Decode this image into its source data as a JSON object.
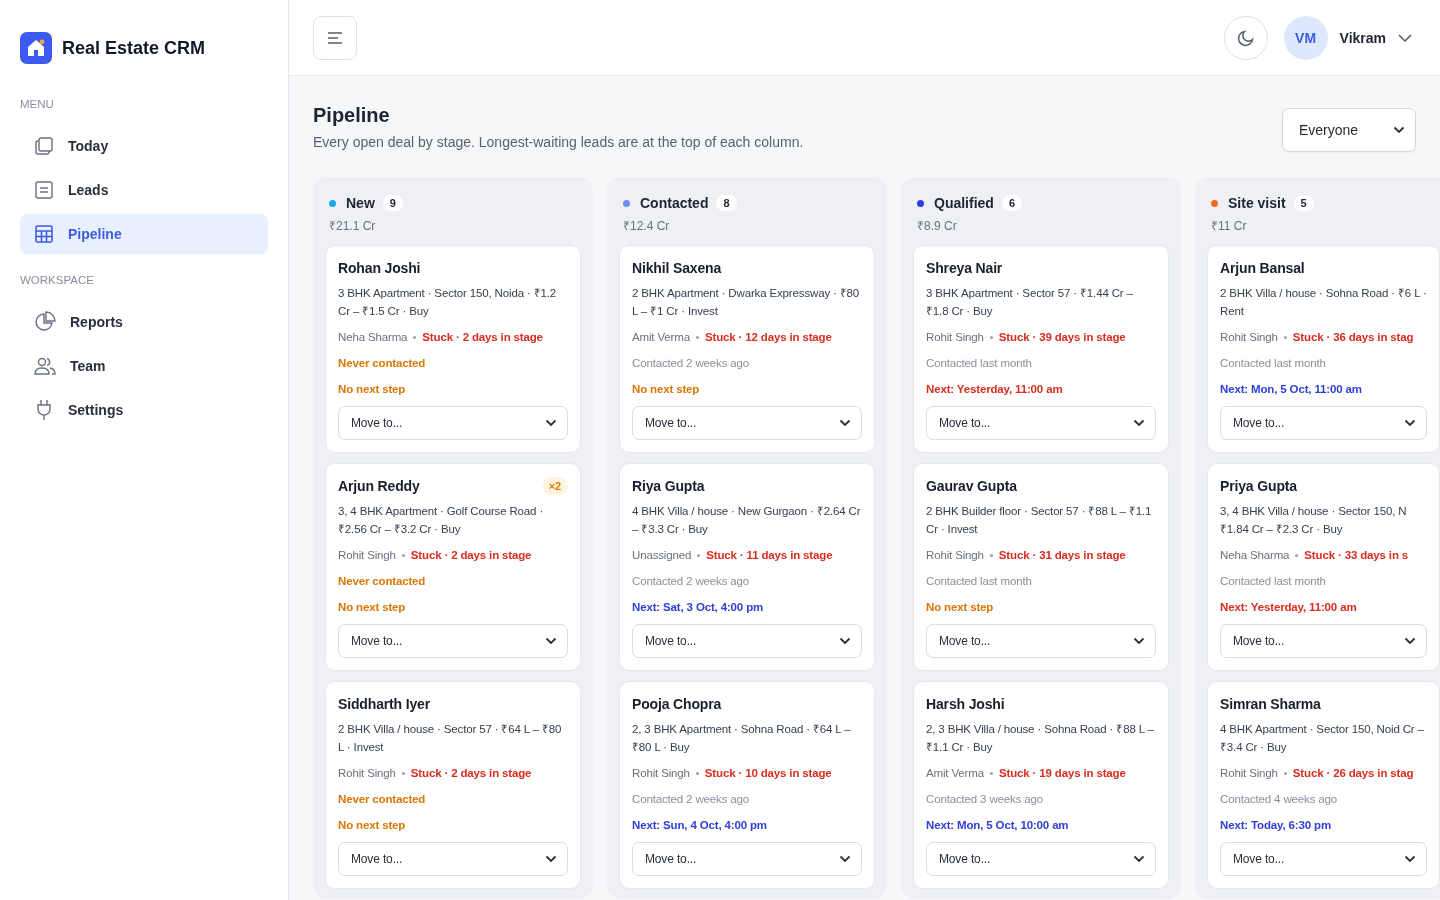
{
  "sidebar": {
    "brand": "Real Estate CRM",
    "sections": [
      {
        "title": "MENU",
        "items": [
          {
            "label": "Today",
            "selected": false
          },
          {
            "label": "Leads",
            "selected": false
          },
          {
            "label": "Pipeline",
            "selected": true
          }
        ]
      },
      {
        "title": "WORKSPACE",
        "items": [
          {
            "label": "Reports",
            "selected": false
          },
          {
            "label": "Team",
            "selected": false
          },
          {
            "label": "Settings",
            "selected": false
          }
        ]
      }
    ]
  },
  "header": {
    "user_initials": "VM",
    "user_name": "Vikram"
  },
  "page": {
    "title": "Pipeline",
    "subtitle": "Every open deal by stage. Longest-waiting leads are at the top of each column.",
    "filter": "Everyone"
  },
  "columns": [
    {
      "name": "New",
      "count": "9",
      "total": "₹21.1 Cr",
      "color": "#1ea7e8",
      "cards": [
        {
          "name": "Rohan Joshi",
          "description": "3 BHK Apartment · Sector 150, Noida · ₹1.2 Cr – ₹1.5 Cr · Buy",
          "owner": "Neha Sharma",
          "stuck": "Stuck · 2 days in stage",
          "contact": {
            "text": "Never contacted",
            "kind": "never"
          },
          "next": {
            "text": "No next step",
            "kind": "none"
          },
          "move": "Move to..."
        },
        {
          "name": "Arjun Reddy",
          "badge": "×2",
          "description": "3, 4 BHK Apartment · Golf Course Road · ₹2.56 Cr – ₹3.2 Cr · Buy",
          "owner": "Rohit Singh",
          "stuck": "Stuck · 2 days in stage",
          "contact": {
            "text": "Never contacted",
            "kind": "never"
          },
          "next": {
            "text": "No next step",
            "kind": "none"
          },
          "move": "Move to..."
        },
        {
          "name": "Siddharth Iyer",
          "description": "2 BHK Villa / house · Sector 57 · ₹64 L – ₹80 L · Invest",
          "owner": "Rohit Singh",
          "stuck": "Stuck · 2 days in stage",
          "contact": {
            "text": "Never contacted",
            "kind": "never"
          },
          "next": {
            "text": "No next step",
            "kind": "none"
          },
          "move": "Move to..."
        }
      ]
    },
    {
      "name": "Contacted",
      "count": "8",
      "total": "₹12.4 Cr",
      "color": "#6b8cf3",
      "cards": [
        {
          "name": "Nikhil Saxena",
          "description": "2 BHK Apartment · Dwarka Expressway · ₹80 L – ₹1 Cr · Invest",
          "owner": "Amit Verma",
          "stuck": "Stuck · 12 days in stage",
          "contact": {
            "text": "Contacted 2 weeks ago",
            "kind": "past"
          },
          "next": {
            "text": "No next step",
            "kind": "none"
          },
          "move": "Move to..."
        },
        {
          "name": "Riya Gupta",
          "description": "4 BHK Villa / house · New Gurgaon · ₹2.64 Cr – ₹3.3 Cr · Buy",
          "owner": "Unassigned",
          "stuck": "Stuck · 11 days in stage",
          "contact": {
            "text": "Contacted 2 weeks ago",
            "kind": "past"
          },
          "next": {
            "text": "Next: Sat, 3 Oct, 4:00 pm",
            "kind": "upcoming"
          },
          "move": "Move to..."
        },
        {
          "name": "Pooja Chopra",
          "description": "2, 3 BHK Apartment · Sohna Road · ₹64 L – ₹80 L · Buy",
          "owner": "Rohit Singh",
          "stuck": "Stuck · 10 days in stage",
          "contact": {
            "text": "Contacted 2 weeks ago",
            "kind": "past"
          },
          "next": {
            "text": "Next: Sun, 4 Oct, 4:00 pm",
            "kind": "upcoming"
          },
          "move": "Move to..."
        }
      ]
    },
    {
      "name": "Qualified",
      "count": "6",
      "total": "₹8.9 Cr",
      "color": "#2b3fe0",
      "cards": [
        {
          "name": "Shreya Nair",
          "description": "3 BHK Apartment · Sector 57 · ₹1.44 Cr – ₹1.8 Cr · Buy",
          "owner": "Rohit Singh",
          "stuck": "Stuck · 39 days in stage",
          "contact": {
            "text": "Contacted last month",
            "kind": "past"
          },
          "next": {
            "text": "Next: Yesterday, 11:00 am",
            "kind": "overdue"
          },
          "move": "Move to..."
        },
        {
          "name": "Gaurav Gupta",
          "description": "2 BHK Builder floor · Sector 57 · ₹88 L – ₹1.1 Cr · Invest",
          "owner": "Rohit Singh",
          "stuck": "Stuck · 31 days in stage",
          "contact": {
            "text": "Contacted last month",
            "kind": "past"
          },
          "next": {
            "text": "No next step",
            "kind": "none"
          },
          "move": "Move to..."
        },
        {
          "name": "Harsh Joshi",
          "description": "2, 3 BHK Villa / house · Sohna Road · ₹88 L – ₹1.1 Cr · Buy",
          "owner": "Amit Verma",
          "stuck": "Stuck · 19 days in stage",
          "contact": {
            "text": "Contacted 3 weeks ago",
            "kind": "past"
          },
          "next": {
            "text": "Next: Mon, 5 Oct, 10:00 am",
            "kind": "upcoming"
          },
          "move": "Move to..."
        }
      ]
    },
    {
      "name": "Site visit",
      "count": "5",
      "total": "₹11 Cr",
      "color": "#f26a1b",
      "cards": [
        {
          "name": "Arjun Bansal",
          "description": "2 BHK Villa / house · Sohna Road · ₹6 L · Rent",
          "owner": "Rohit Singh",
          "stuck": "Stuck · 36 days in stag",
          "contact": {
            "text": "Contacted last month",
            "kind": "past"
          },
          "next": {
            "text": "Next: Mon, 5 Oct, 11:00 am",
            "kind": "upcoming"
          },
          "move": "Move to..."
        },
        {
          "name": "Priya Gupta",
          "description": "3, 4 BHK Villa / house · Sector 150, N ₹1.84 Cr – ₹2.3 Cr · Buy",
          "owner": "Neha Sharma",
          "stuck": "Stuck · 33 days in s",
          "contact": {
            "text": "Contacted last month",
            "kind": "past"
          },
          "next": {
            "text": "Next: Yesterday, 11:00 am",
            "kind": "overdue"
          },
          "move": "Move to..."
        },
        {
          "name": "Simran Sharma",
          "description": "4 BHK Apartment · Sector 150, Noid Cr – ₹3.4 Cr · Buy",
          "owner": "Rohit Singh",
          "stuck": "Stuck · 26 days in stag",
          "contact": {
            "text": "Contacted 4 weeks ago",
            "kind": "past"
          },
          "next": {
            "text": "Next: Today, 6:30 pm",
            "kind": "upcoming"
          },
          "move": "Move to..."
        }
      ]
    }
  ]
}
